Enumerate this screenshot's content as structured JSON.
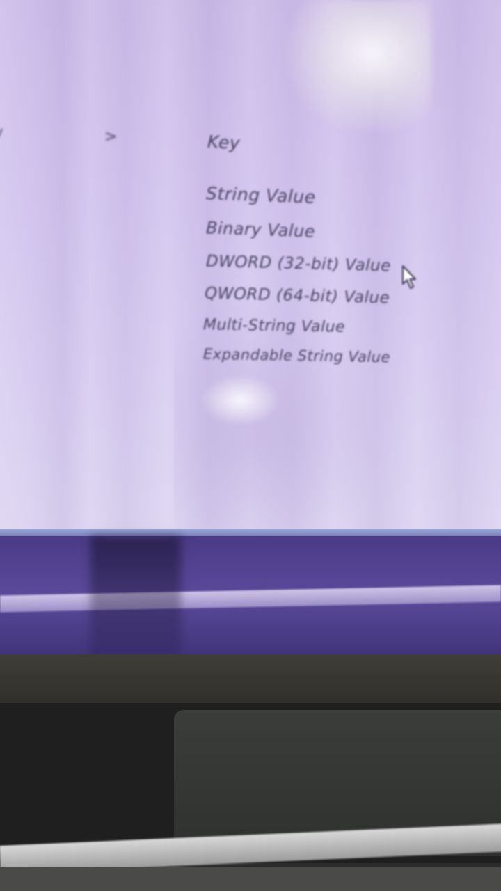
{
  "context_menu": {
    "submenu_arrow": ">",
    "items": [
      {
        "label": "Key"
      },
      {
        "label": "String Value"
      },
      {
        "label": "Binary Value"
      },
      {
        "label": "DWORD (32-bit) Value"
      },
      {
        "label": "QWORD (64-bit) Value"
      },
      {
        "label": "Multi-String Value"
      },
      {
        "label": "Expandable String Value"
      }
    ]
  },
  "colors": {
    "screen_background": "#d3c6ee",
    "menu_text": "#4a4563"
  },
  "icons": {
    "submenu": "chevron-right-icon",
    "pointer": "mouse-cursor-icon"
  }
}
